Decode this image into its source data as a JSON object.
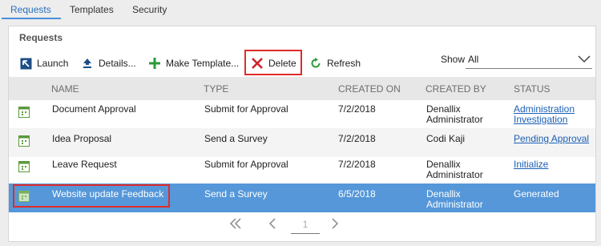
{
  "tabs": [
    {
      "label": "Requests"
    },
    {
      "label": "Templates"
    },
    {
      "label": "Security"
    }
  ],
  "panel": {
    "title": "Requests",
    "toolbar": {
      "launch": "Launch",
      "details": "Details...",
      "make_template": "Make Template...",
      "delete": "Delete",
      "refresh": "Refresh"
    },
    "show": {
      "label": "Show",
      "value": "All"
    }
  },
  "table": {
    "headers": {
      "name": "NAME",
      "type": "TYPE",
      "created_on": "CREATED ON",
      "created_by": "CREATED BY",
      "status": "STATUS"
    },
    "rows": [
      {
        "name": "Document Approval",
        "type": "Submit for Approval",
        "created_on": "7/2/2018",
        "created_by_1": "Denallix",
        "created_by_2": "Administrator",
        "status_1": "Administration",
        "status_2": "Investigation"
      },
      {
        "name": "Idea Proposal",
        "type": "Send a Survey",
        "created_on": "7/2/2018",
        "created_by_1": "Codi Kaji",
        "created_by_2": "",
        "status_1": "Pending Approval",
        "status_2": ""
      },
      {
        "name": "Leave Request",
        "type": "Submit for Approval",
        "created_on": "7/2/2018",
        "created_by_1": "Denallix",
        "created_by_2": "Administrator",
        "status_1": "Initialize",
        "status_2": ""
      },
      {
        "name": "Website update Feedback",
        "type": "Send a Survey",
        "created_on": "6/5/2018",
        "created_by_1": "Denallix",
        "created_by_2": "Administrator",
        "status_1": "Generated",
        "status_2": ""
      }
    ]
  },
  "pager": {
    "page": "1"
  },
  "colors": {
    "accent": "#4a90d9",
    "selected_row": "#5597d9",
    "highlight_box": "#e02b2b",
    "link": "#1a5fb4"
  }
}
